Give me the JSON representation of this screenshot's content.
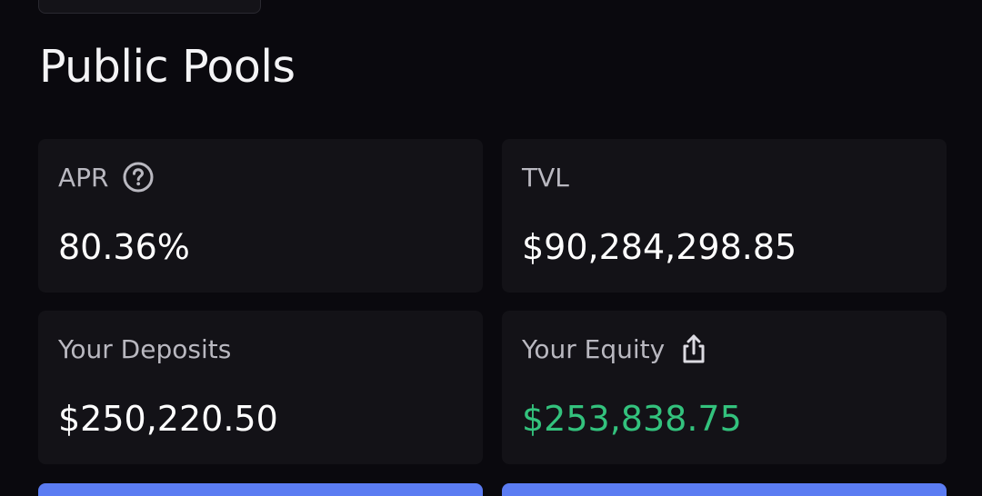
{
  "page": {
    "title": "Public Pools"
  },
  "stats": {
    "apr": {
      "label": "APR",
      "value": "80.36%",
      "icon": "help-circle-icon"
    },
    "tvl": {
      "label": "TVL",
      "value": "$90,284,298.85"
    },
    "deposits": {
      "label": "Your Deposits",
      "value": "$250,220.50"
    },
    "equity": {
      "label": "Your Equity",
      "value": "$253,838.75",
      "icon": "share-icon",
      "value_color": "#33c27d"
    }
  },
  "actions": {
    "primary_color": "#5b7cf2"
  }
}
